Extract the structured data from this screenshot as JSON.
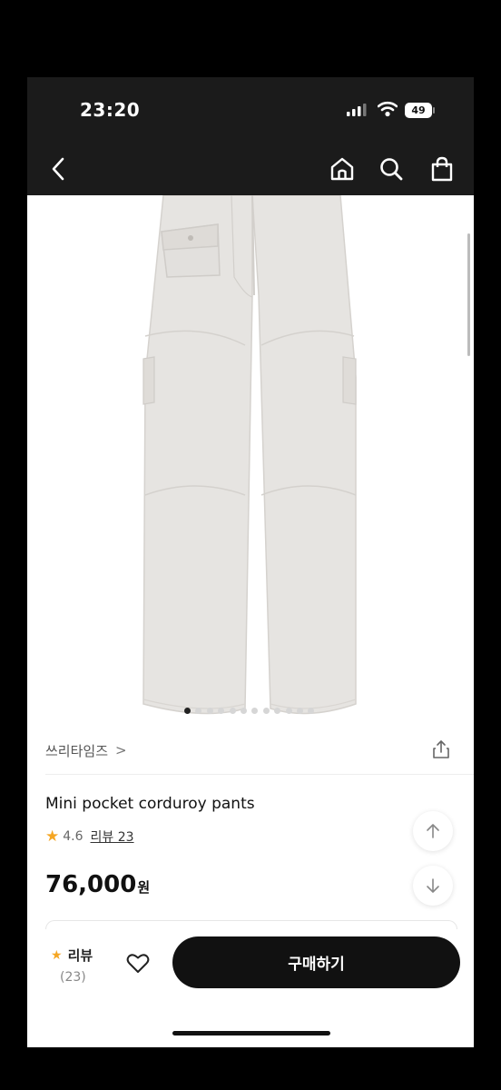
{
  "status_bar": {
    "time": "23:20",
    "battery": "49"
  },
  "nav": {
    "back_icon": "chevron-left-icon",
    "home_icon": "home-icon",
    "search_icon": "search-icon",
    "bag_icon": "shopping-bag-icon"
  },
  "image_carousel": {
    "dot_count": 12,
    "active_index": 0
  },
  "brand": {
    "name": "쓰리타임즈",
    "chevron": ">"
  },
  "product": {
    "name": "Mini pocket corduroy pants",
    "rating": "4.6",
    "review_label": "리뷰 23",
    "price": "76,000",
    "currency": "원"
  },
  "bottom_bar": {
    "review_label": "리뷰",
    "review_count": "(23)",
    "buy_label": "구매하기"
  },
  "colors": {
    "dark_bar": "#1b1b1b",
    "accent_star": "#f5a623",
    "button": "#111111",
    "pants": "#e6e4e1"
  }
}
